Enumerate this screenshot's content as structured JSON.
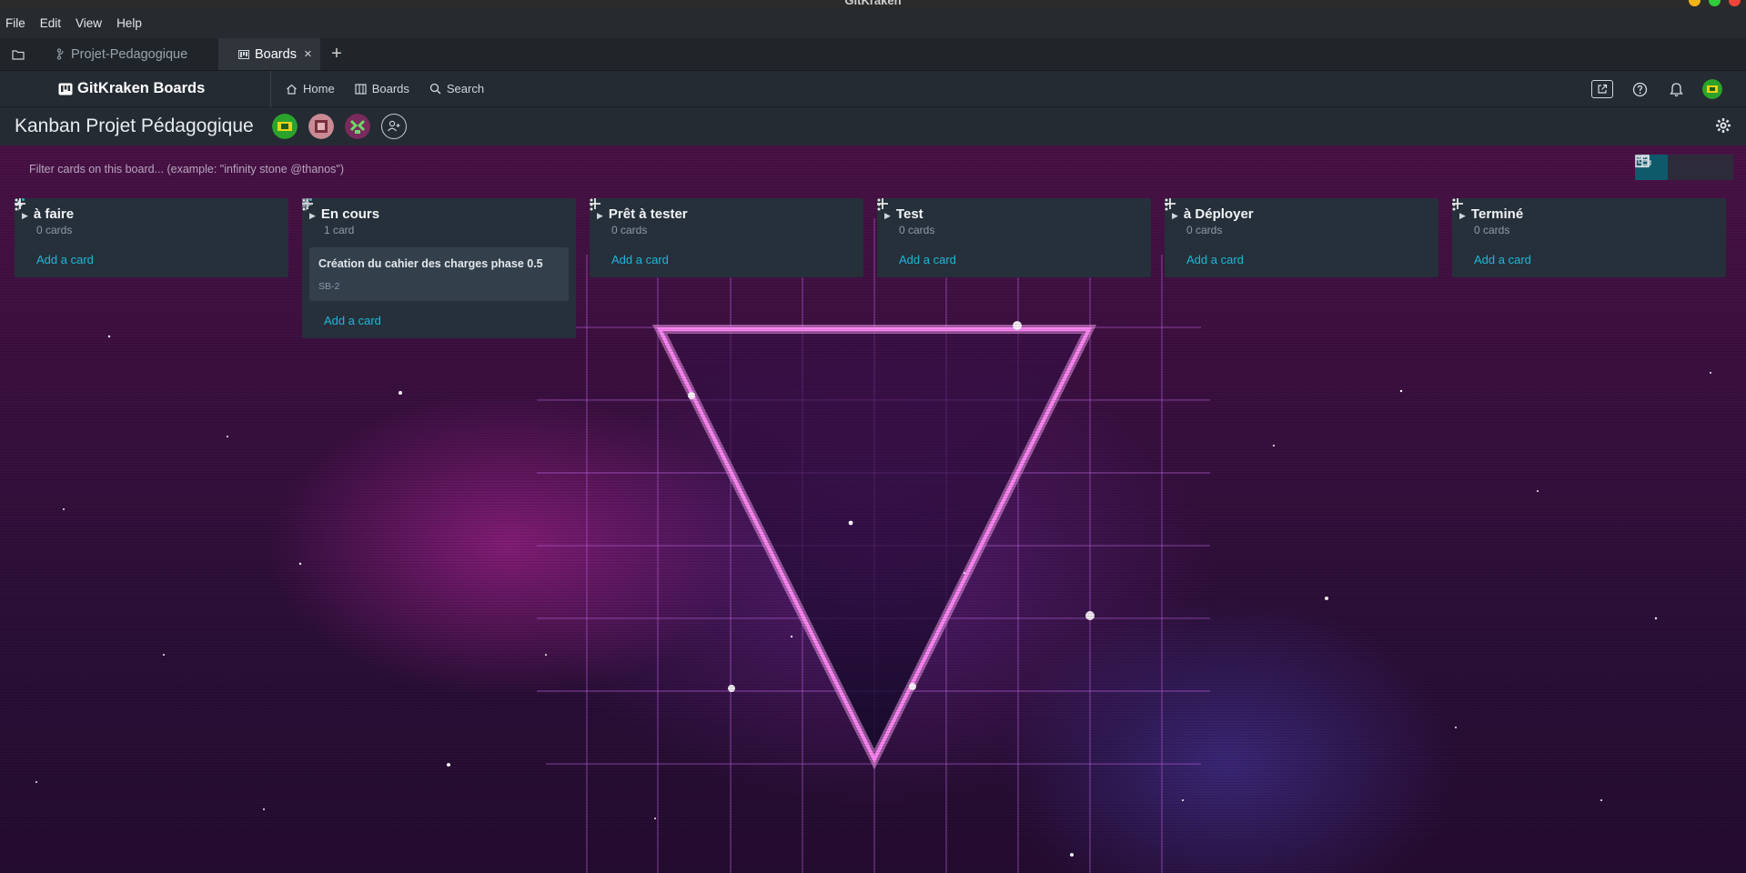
{
  "window": {
    "title": "GitKraken",
    "controls": {
      "minimize_color": "#f5b31a",
      "maximize_color": "#2fcc3c",
      "close_color": "#f0443a"
    }
  },
  "menubar": {
    "items": [
      "File",
      "Edit",
      "View",
      "Help"
    ]
  },
  "tabs": {
    "items": [
      {
        "label": "Projet-Pedagogique",
        "icon": "git-branch-icon",
        "active": false
      },
      {
        "label": "Boards",
        "icon": "board-icon",
        "active": true
      }
    ],
    "close_icon": "×",
    "add_icon": "+"
  },
  "appnav": {
    "brand": "GitKraken Boards",
    "links": [
      {
        "label": "Home",
        "icon": "home-icon"
      },
      {
        "label": "Boards",
        "icon": "boards-icon"
      },
      {
        "label": "Search",
        "icon": "search-icon"
      }
    ]
  },
  "board": {
    "title": "Kanban Projet Pédagogique",
    "filter_placeholder": "Filter cards on this board... (example: \"infinity stone @thanos\")",
    "accent_color": "#1fb7d8",
    "columns": [
      {
        "title": "à faire",
        "count": "0 cards",
        "add_label": "Add a card",
        "automation": true,
        "cards": []
      },
      {
        "title": "En cours",
        "count": "1 card",
        "add_label": "Add a card",
        "automation": true,
        "cards": [
          {
            "title": "Création du cahier des charges phase 0.5",
            "id": "SB-2",
            "has_description": true
          }
        ]
      },
      {
        "title": "Prêt à tester",
        "count": "0 cards",
        "add_label": "Add a card",
        "automation": false,
        "cards": []
      },
      {
        "title": "Test",
        "count": "0 cards",
        "add_label": "Add a card",
        "automation": false,
        "cards": []
      },
      {
        "title": "à Déployer",
        "count": "0 cards",
        "add_label": "Add a card",
        "automation": false,
        "cards": []
      },
      {
        "title": "Terminé",
        "count": "0 cards",
        "add_label": "Add a card",
        "automation": false,
        "cards": []
      }
    ]
  }
}
